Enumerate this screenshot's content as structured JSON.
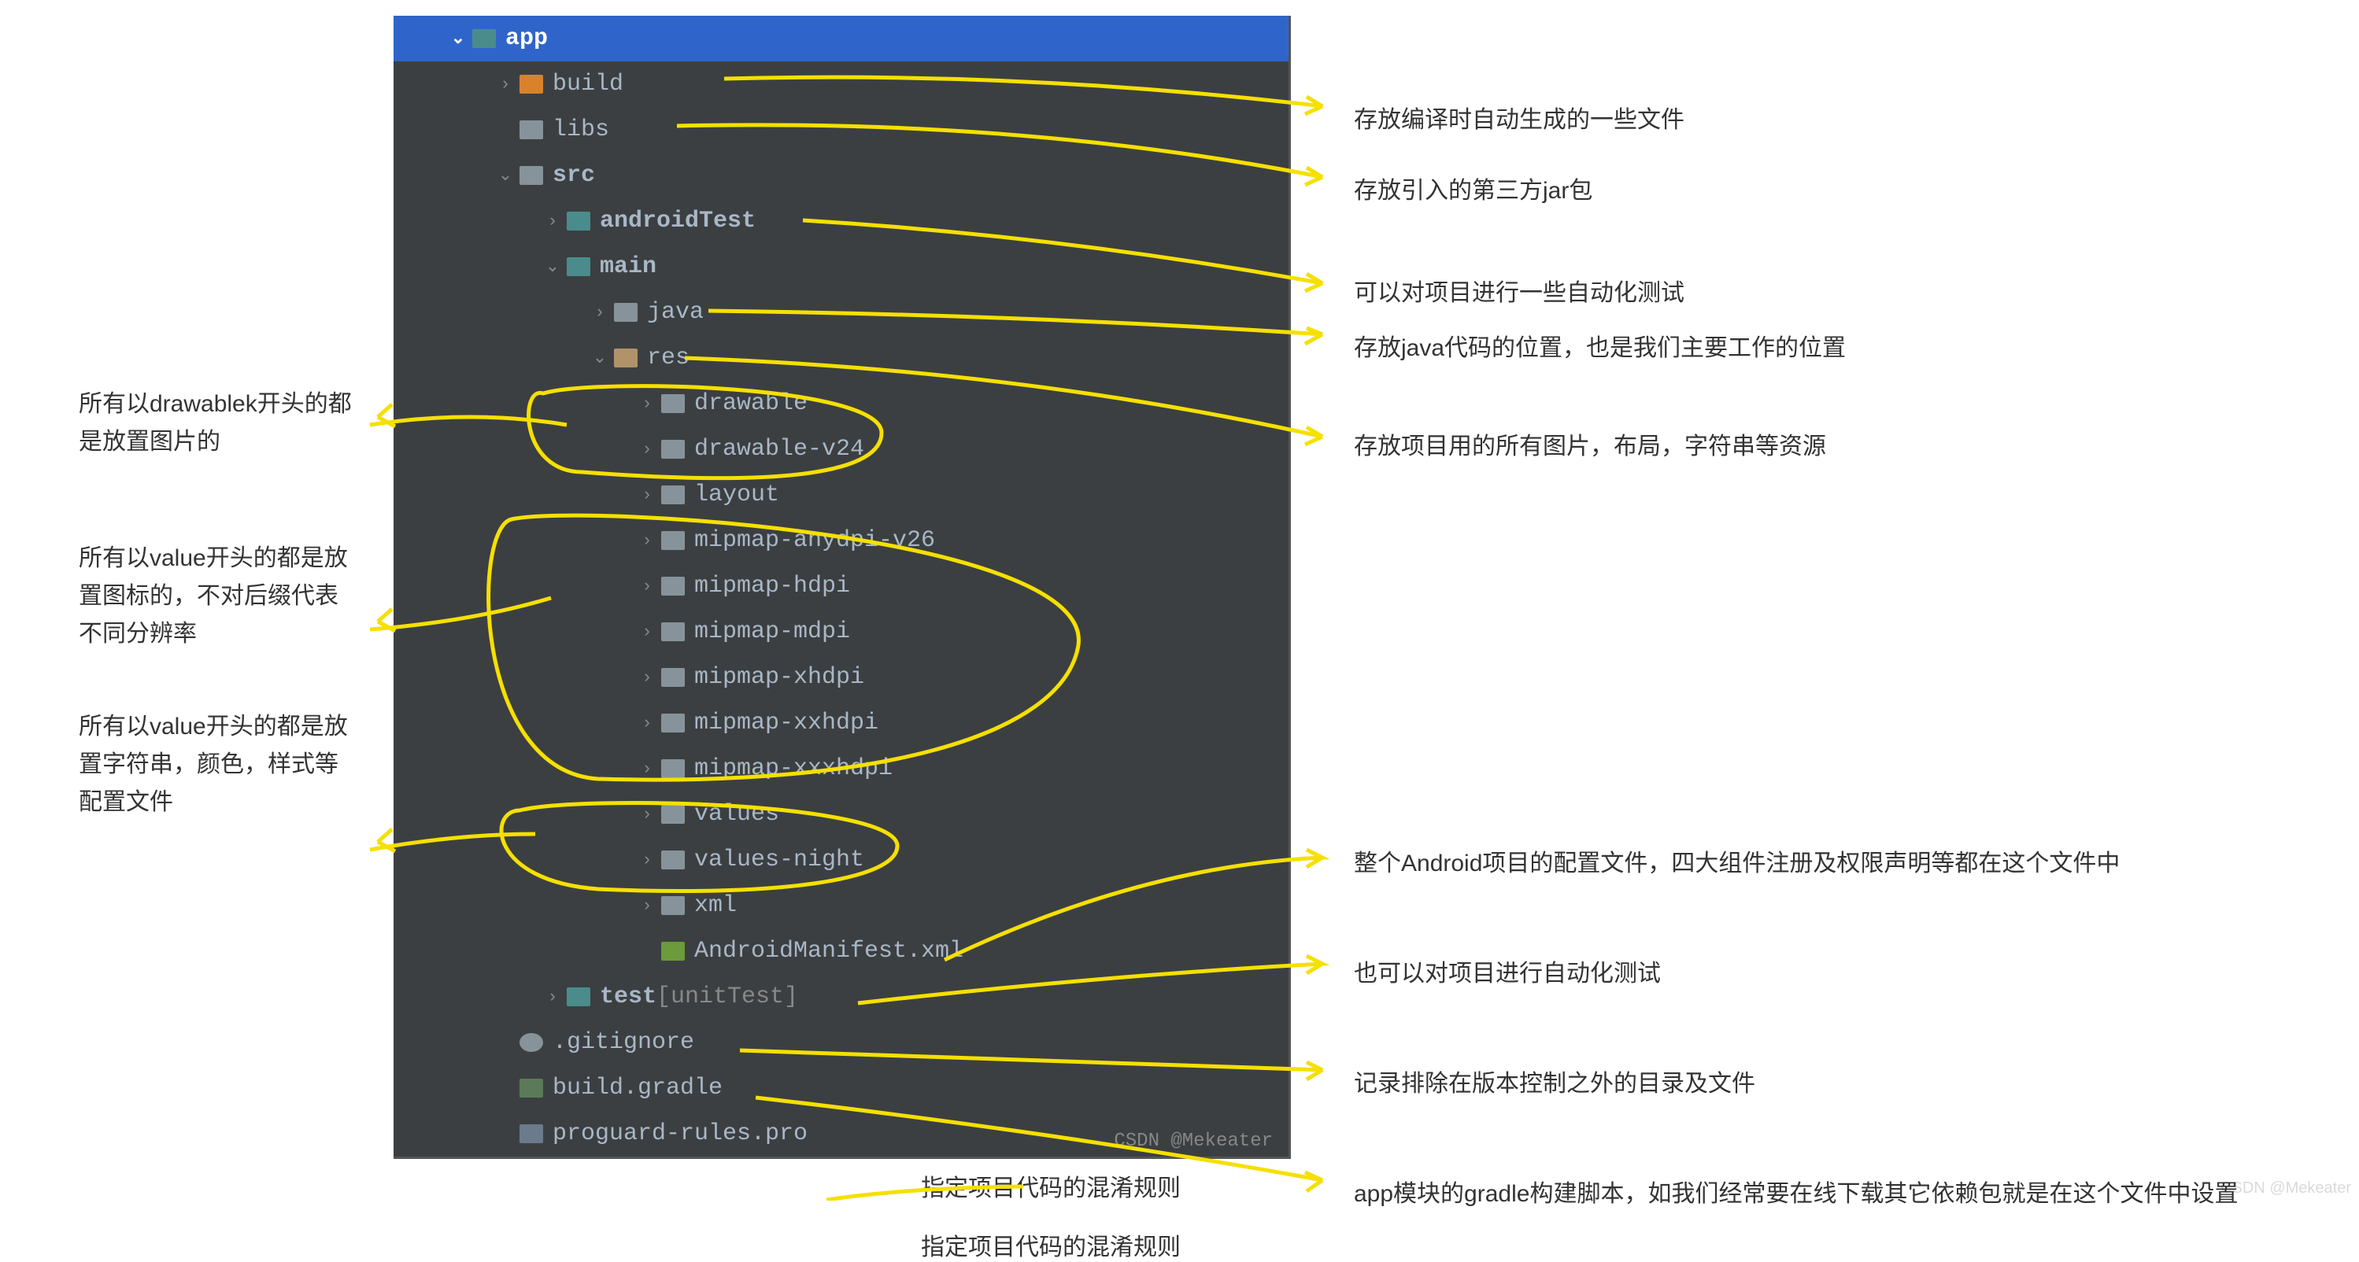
{
  "left_notes": [
    "所有以drawablek开头的都是放置图片的",
    "所有以value开头的都是放置图标的，不对后缀代表不同分辨率",
    "所有以value开头的都是放置字符串，颜色，样式等配置文件"
  ],
  "tree": {
    "app": "app",
    "build": "build",
    "libs": "libs",
    "src": "src",
    "androidTest": "androidTest",
    "main": "main",
    "java": "java",
    "res": "res",
    "drawable": "drawable",
    "drawable_v24": "drawable-v24",
    "layout": "layout",
    "mipmap_anydpi_v26": "mipmap-anydpi-v26",
    "mipmap_hdpi": "mipmap-hdpi",
    "mipmap_mdpi": "mipmap-mdpi",
    "mipmap_xhdpi": "mipmap-xhdpi",
    "mipmap_xxhdpi": "mipmap-xxhdpi",
    "mipmap_xxxhdpi": "mipmap-xxxhdpi",
    "values": "values",
    "values_night": "values-night",
    "xml": "xml",
    "manifest": "AndroidManifest.xml",
    "test": "test",
    "test_suffix": " [unitTest]",
    "gitignore": ".gitignore",
    "build_gradle": "build.gradle",
    "proguard": "proguard-rules.pro"
  },
  "watermark": "CSDN @Mekeater",
  "right_notes": {
    "n1": "存放编译时自动生成的一些文件",
    "n2": "存放引入的第三方jar包",
    "n3": "可以对项目进行一些自动化测试",
    "n4": "存放java代码的位置，也是我们主要工作的位置",
    "n5": "存放项目用的所有图片，布局，字符串等资源",
    "n6": "整个Android项目的配置文件，四大组件注册及权限声明等都在这个文件中",
    "n7": "也可以对项目进行自动化测试",
    "n8": "记录排除在版本控制之外的目录及文件",
    "n9": "app模块的gradle构建脚本，如我们经常要在线下载其它依赖包就是在这个文件中设置"
  },
  "bottom_note": "指定项目代码的混淆规则",
  "footer_watermark": "CSDN @Mekeater"
}
